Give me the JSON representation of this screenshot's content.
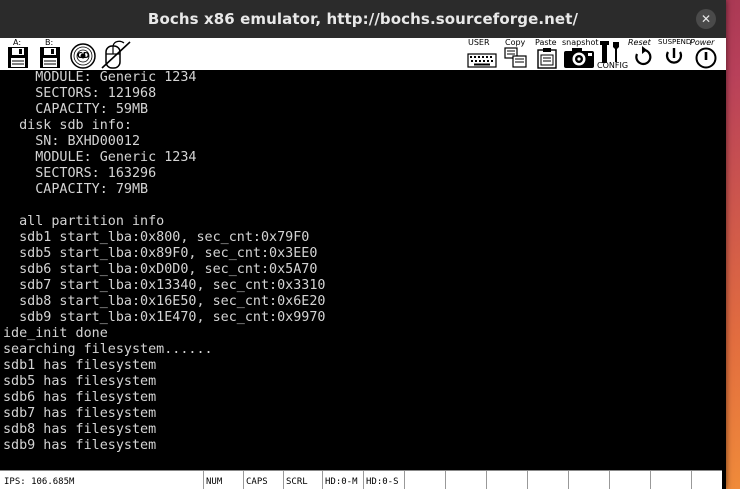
{
  "window": {
    "title": "Bochs x86 emulator, http://bochs.sourceforge.net/",
    "close_glyph": "✕"
  },
  "toolbar": {
    "floppy_a": "A:",
    "floppy_b": "B:",
    "cdrom": "CD",
    "user": "USER",
    "copy": "Copy",
    "paste": "Paste",
    "snapshot": "snapshot",
    "config": "CONFIG",
    "reset": "Reset",
    "suspend": "SUSPEND",
    "power": "Power"
  },
  "console": {
    "lines": [
      "    MODULE: Generic 1234",
      "    SECTORS: 121968",
      "    CAPACITY: 59MB",
      "  disk sdb info:",
      "    SN: BXHD00012",
      "    MODULE: Generic 1234",
      "    SECTORS: 163296",
      "    CAPACITY: 79MB",
      "",
      "  all partition info",
      "  sdb1 start_lba:0x800, sec_cnt:0x79F0",
      "  sdb5 start_lba:0x89F0, sec_cnt:0x3EE0",
      "  sdb6 start_lba:0xD0D0, sec_cnt:0x5A70",
      "  sdb7 start_lba:0x13340, sec_cnt:0x3310",
      "  sdb8 start_lba:0x16E50, sec_cnt:0x6E20",
      "  sdb9 start_lba:0x1E470, sec_cnt:0x9970",
      "ide_init done",
      "searching filesystem......",
      "sdb1 has filesystem",
      "sdb5 has filesystem",
      "sdb6 has filesystem",
      "sdb7 has filesystem",
      "sdb8 has filesystem",
      "sdb9 has filesystem"
    ]
  },
  "status": {
    "ips": "IPS: 106.685M",
    "num": "NUM",
    "caps": "CAPS",
    "scrl": "SCRL",
    "hd0m": "HD:0-M",
    "hd0s": "HD:0-S"
  },
  "colors": {
    "console_text": "#d4d4d4",
    "console_bg": "#000000",
    "titlebar_bg": "#2b2b2b"
  }
}
